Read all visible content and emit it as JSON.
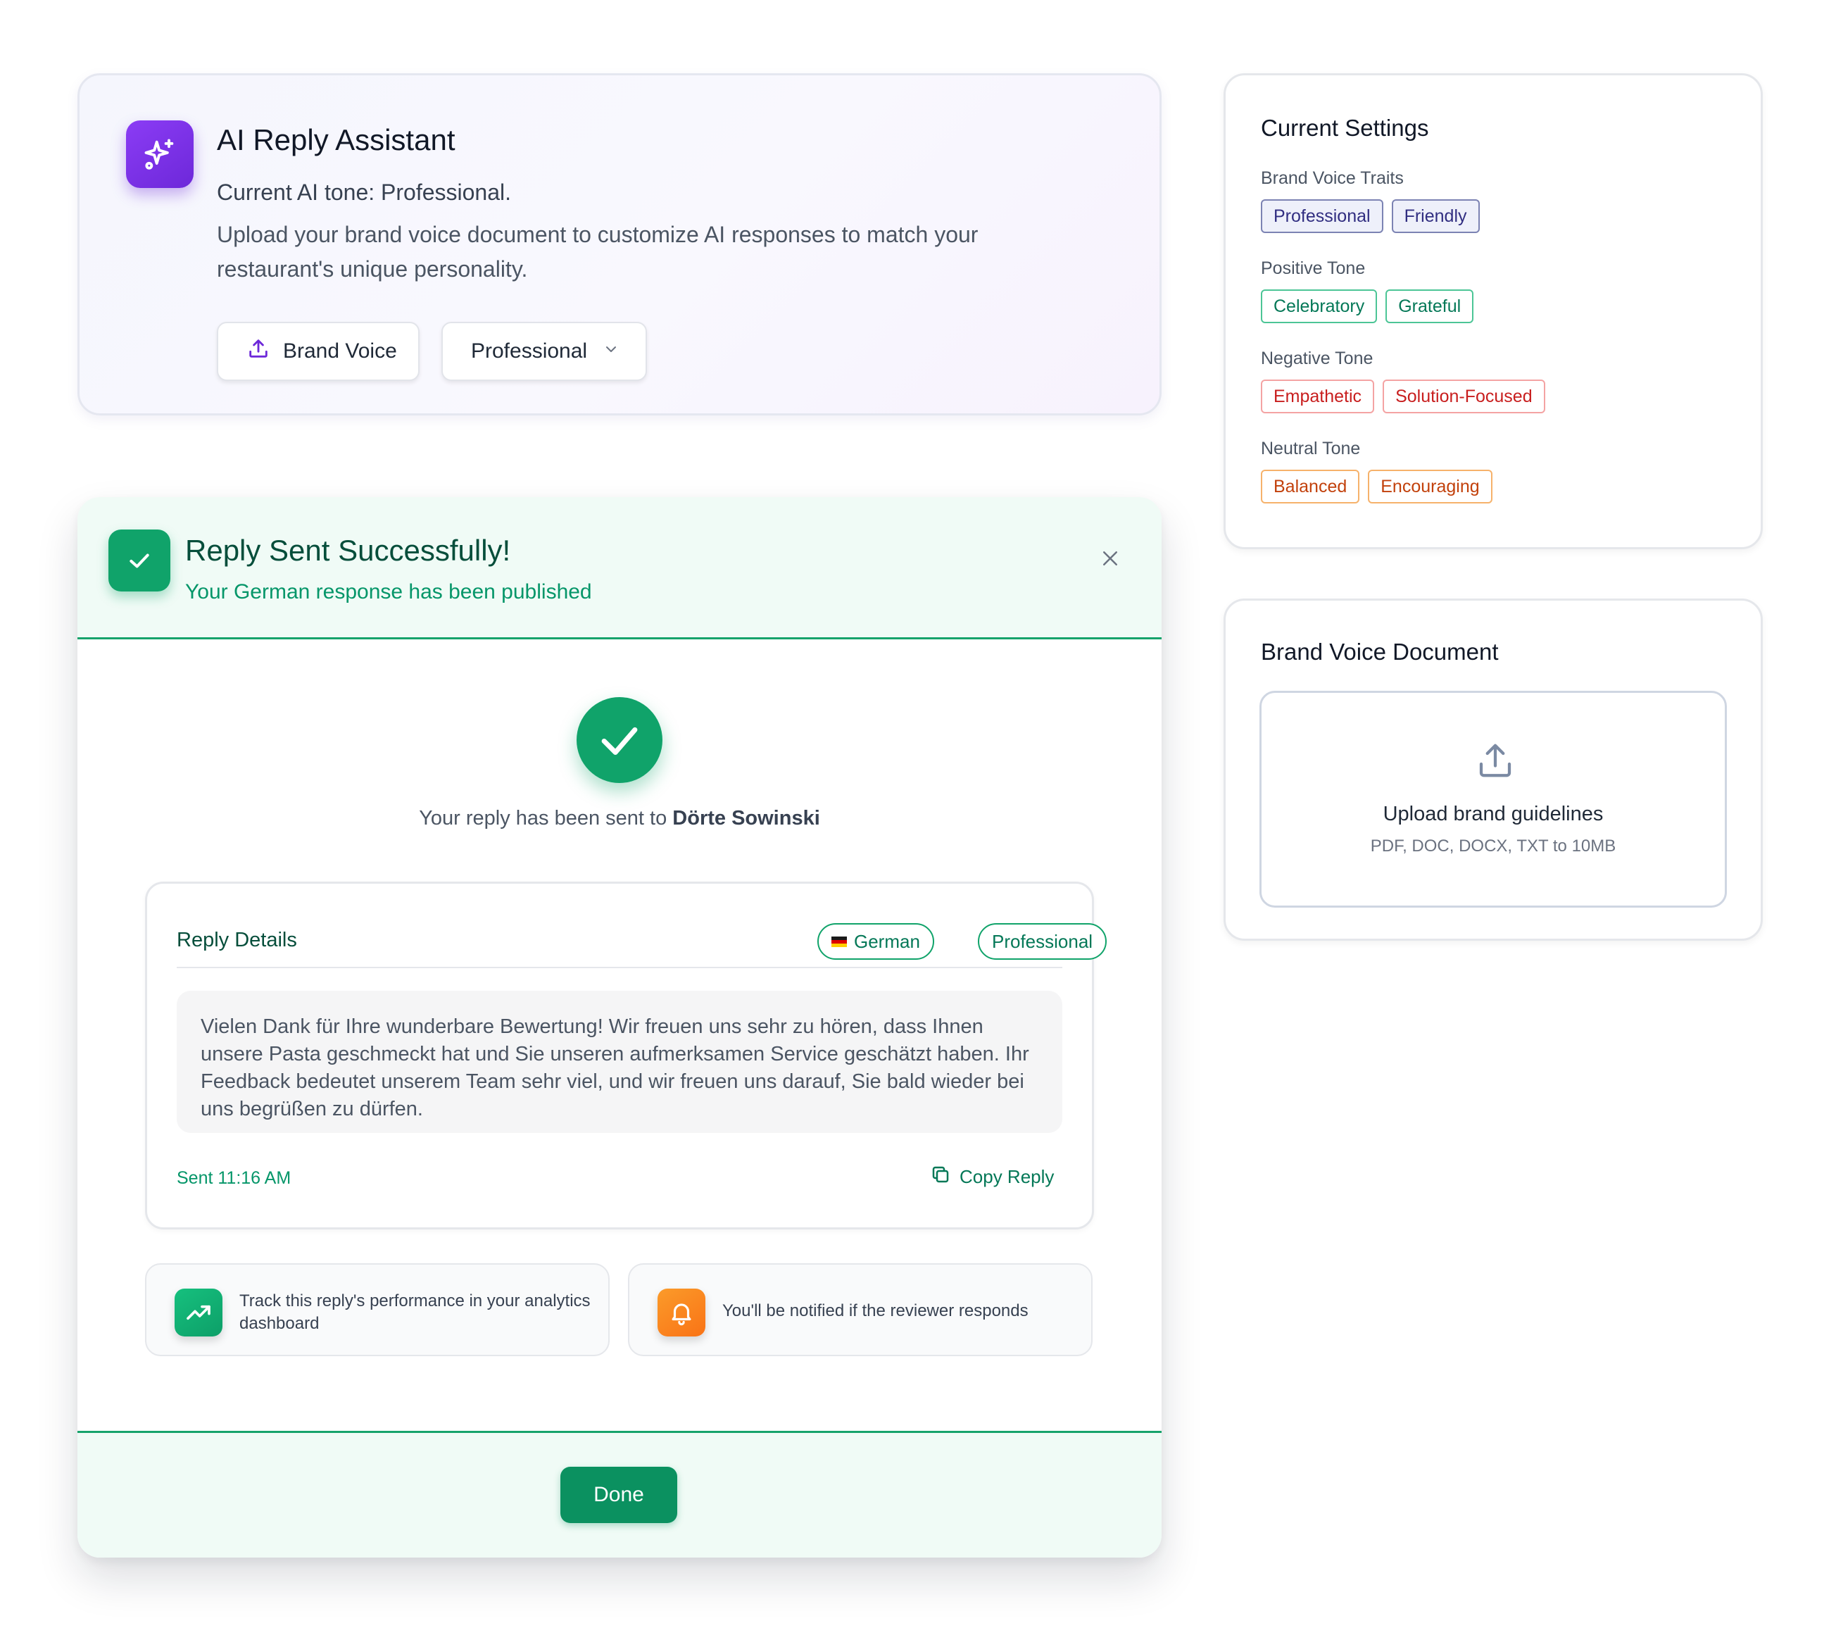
{
  "assistant": {
    "title": "AI Reply Assistant",
    "tone_line": "Current AI tone: Professional.",
    "description": "Upload your brand voice document to customize AI responses to match your restaurant's unique personality.",
    "brand_voice_button": "Brand Voice",
    "tone_select_value": "Professional",
    "icons": {
      "assistant": "sparkles-icon",
      "upload": "upload-icon",
      "dropdown": "chevron-down-icon"
    },
    "accent_color": "#7c3aed"
  },
  "dialog": {
    "title": "Reply Sent Successfully!",
    "subtitle": "Your German response has been published",
    "sent_to_prefix": "Your reply has been sent to ",
    "recipient": "Dörte Sowinski",
    "details": {
      "title": "Reply Details",
      "language_badge": "German",
      "tone_badge": "Professional",
      "reply_text": "Vielen Dank für Ihre wunderbare Bewertung! Wir freuen uns sehr zu hören, dass Ihnen unsere Pasta geschmeckt hat und Sie unseren aufmerksamen Service geschätzt haben. Ihr Feedback bedeutet unserem Team sehr viel, und wir freuen uns darauf, Sie bald wieder bei uns begrüßen zu dürfen.",
      "sent_time": "Sent 11:16 AM",
      "copy_label": "Copy Reply"
    },
    "info": {
      "analytics": "Track this reply's performance in your analytics dashboard",
      "notify": "You'll be notified if the reviewer responds"
    },
    "done_label": "Done",
    "success_color": "#10a36a",
    "icons": {
      "header": "check-icon",
      "close": "close-icon",
      "copy": "copy-icon",
      "analytics": "trending-up-icon",
      "notify": "bell-icon"
    }
  },
  "settings": {
    "title": "Current Settings",
    "groups": [
      {
        "label": "Brand Voice Traits",
        "tags": [
          "Professional",
          "Friendly"
        ],
        "color": "#312e81"
      },
      {
        "label": "Positive Tone",
        "tags": [
          "Celebratory",
          "Grateful"
        ],
        "color": "#047857"
      },
      {
        "label": "Negative Tone",
        "tags": [
          "Empathetic",
          "Solution-Focused"
        ],
        "color": "#c81e1e"
      },
      {
        "label": "Neutral Tone",
        "tags": [
          "Balanced",
          "Encouraging"
        ],
        "color": "#c2410c"
      }
    ]
  },
  "brand_doc": {
    "title": "Brand Voice Document",
    "upload_title": "Upload brand guidelines",
    "upload_formats": "PDF, DOC, DOCX, TXT to 10MB",
    "icon": "upload-icon"
  }
}
